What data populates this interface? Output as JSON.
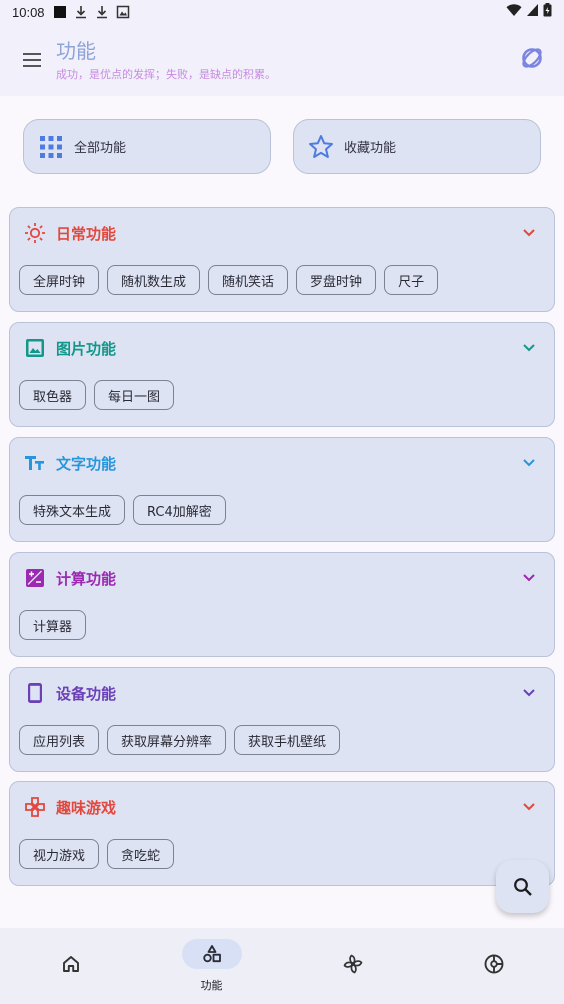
{
  "status_bar": {
    "time": "10:08"
  },
  "app_bar": {
    "title": "功能",
    "subtitle": "成功，是优点的发挥；失败，是缺点的积累。"
  },
  "top_buttons": [
    {
      "label": "全部功能",
      "icon": "grid-icon"
    },
    {
      "label": "收藏功能",
      "icon": "star-icon"
    }
  ],
  "categories": [
    {
      "title": "日常功能",
      "icon": "sun-icon",
      "color": "#e2483d",
      "items": [
        "全屏时钟",
        "随机数生成",
        "随机笑话",
        "罗盘时钟",
        "尺子"
      ]
    },
    {
      "title": "图片功能",
      "icon": "image-icon",
      "color": "#12988a",
      "items": [
        "取色器",
        "每日一图"
      ]
    },
    {
      "title": "文字功能",
      "icon": "text-icon",
      "color": "#2696dc",
      "items": [
        "特殊文本生成",
        "RC4加解密"
      ]
    },
    {
      "title": "计算功能",
      "icon": "calculator-icon",
      "color": "#9c29b1",
      "items": [
        "计算器"
      ]
    },
    {
      "title": "设备功能",
      "icon": "phone-icon",
      "color": "#6a3fb8",
      "items": [
        "应用列表",
        "获取屏幕分辨率",
        "获取手机壁纸"
      ]
    },
    {
      "title": "趣味游戏",
      "icon": "gamepad-icon",
      "color": "#e2483d",
      "items": [
        "视力游戏",
        "贪吃蛇"
      ]
    }
  ],
  "bottom_nav": {
    "items": [
      {
        "icon": "home-icon",
        "label": ""
      },
      {
        "icon": "shapes-icon",
        "label": "功能",
        "active": true
      },
      {
        "icon": "pinwheel-icon",
        "label": ""
      },
      {
        "icon": "chart-icon",
        "label": ""
      }
    ]
  },
  "colors": {
    "accent": "#8ea4d8",
    "card_bg": "#dde3f3",
    "subtitle": "#c88be0"
  }
}
